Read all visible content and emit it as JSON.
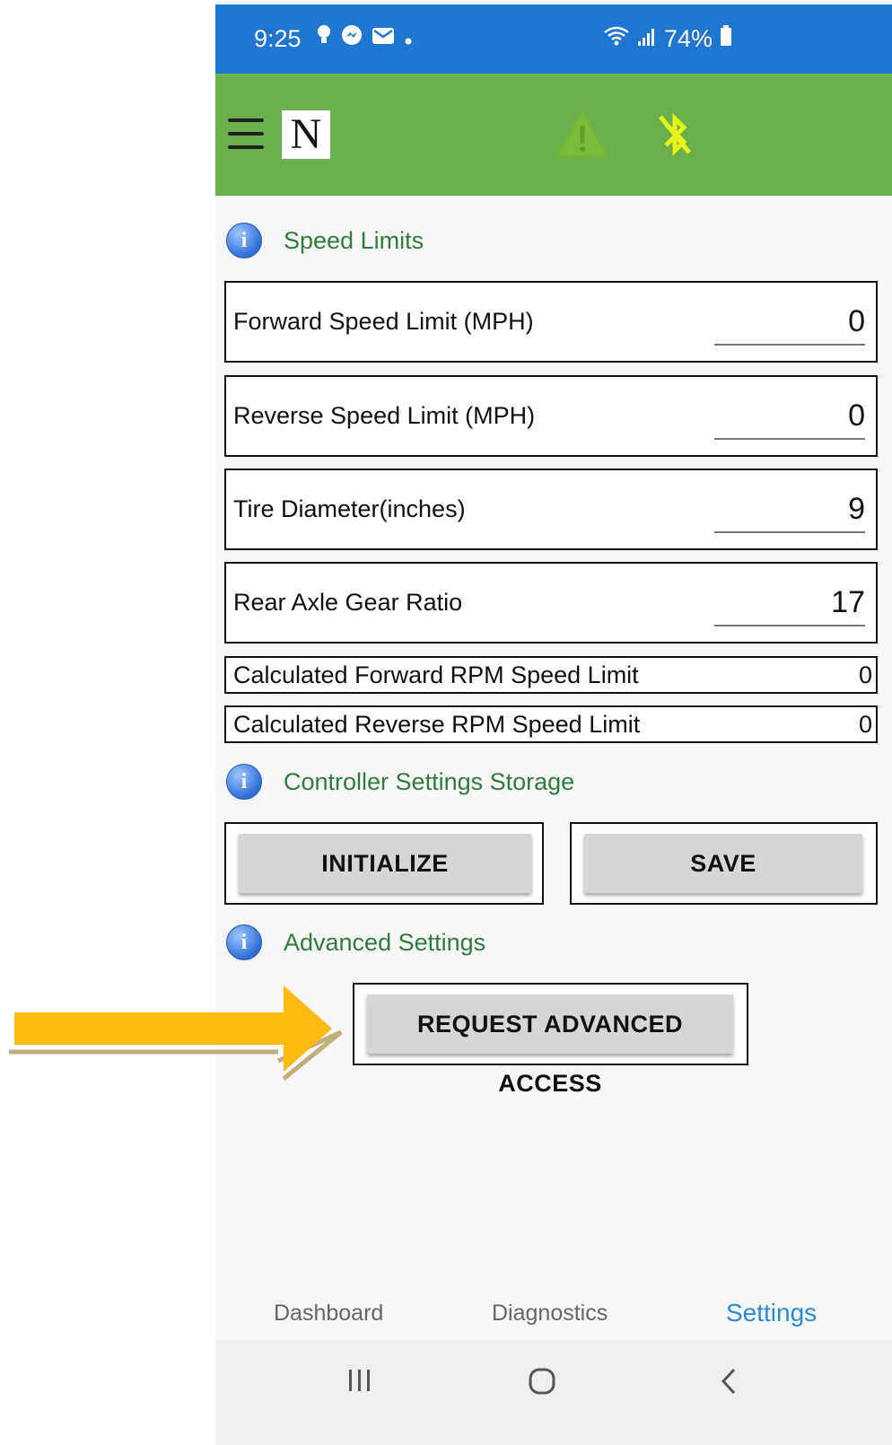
{
  "status_bar": {
    "time": "9:25",
    "battery": "74%"
  },
  "app_bar": {
    "logo_letter": "N"
  },
  "sections": {
    "speed_limits": {
      "title": "Speed Limits",
      "info": "i"
    },
    "storage": {
      "title": "Controller Settings Storage",
      "info": "i"
    },
    "advanced": {
      "title": "Advanced Settings",
      "info": "i"
    }
  },
  "fields": {
    "forward_speed": {
      "label": "Forward Speed Limit (MPH)",
      "value": "0"
    },
    "reverse_speed": {
      "label": "Reverse Speed Limit (MPH)",
      "value": "0"
    },
    "tire_diameter": {
      "label": "Tire Diameter(inches)",
      "value": "9"
    },
    "axle_ratio": {
      "label": "Rear Axle Gear Ratio",
      "value": "17"
    },
    "calc_forward": {
      "label": "Calculated Forward RPM Speed Limit",
      "value": "0"
    },
    "calc_reverse": {
      "label": "Calculated Reverse RPM Speed Limit",
      "value": "0"
    }
  },
  "buttons": {
    "initialize": "INITIALIZE",
    "save": "SAVE",
    "request_advanced": "REQUEST ADVANCED ACCESS"
  },
  "tabs": {
    "dashboard": "Dashboard",
    "diagnostics": "Diagnostics",
    "settings": "Settings",
    "active": "Settings"
  },
  "colors": {
    "status_bar": "#1f76d0",
    "app_bar": "#6ab04c",
    "section_title": "#2f7d3a",
    "active_tab": "#2a8ad4",
    "arrow": "#fdba12",
    "bluetooth_icon": "#e6f21a"
  },
  "icons": {
    "menu": "hamburger-menu-icon",
    "warning": "warning-triangle-icon",
    "bluetooth": "bluetooth-disabled-icon",
    "info": "info-icon",
    "wifi": "wifi-icon",
    "signal": "signal-icon",
    "battery": "battery-icon"
  }
}
